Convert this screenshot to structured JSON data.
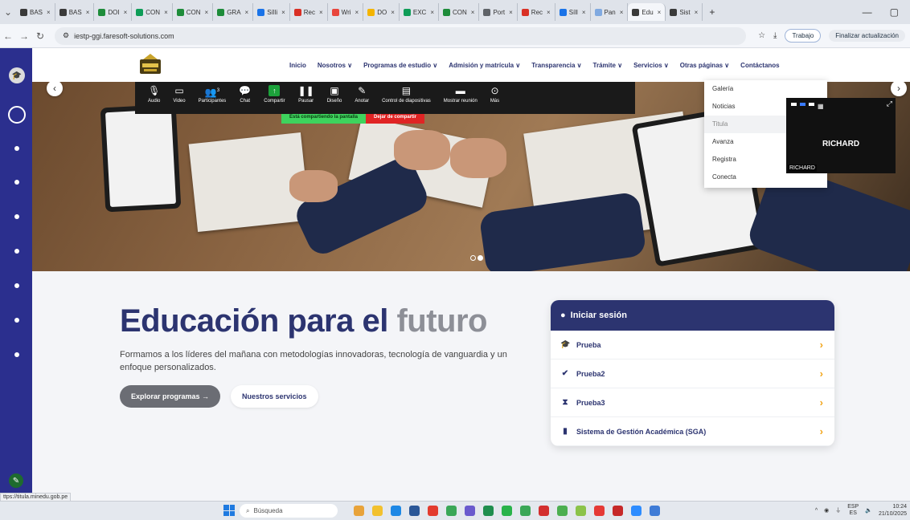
{
  "browser": {
    "tabs": [
      {
        "label": "BAS",
        "color": "#3a3a3a"
      },
      {
        "label": "BAS",
        "color": "#3a3a3a"
      },
      {
        "label": "DOI",
        "color": "#1e8c3a"
      },
      {
        "label": "CON",
        "color": "#0f9d58"
      },
      {
        "label": "CON",
        "color": "#1e8c3a"
      },
      {
        "label": "GRA",
        "color": "#1e8c3a"
      },
      {
        "label": "Sílli",
        "color": "#1a73e8"
      },
      {
        "label": "Rec",
        "color": "#d93025"
      },
      {
        "label": "Wri",
        "color": "#e8453c"
      },
      {
        "label": "DO",
        "color": "#f4b400"
      },
      {
        "label": "EXC",
        "color": "#0f9d58"
      },
      {
        "label": "CON",
        "color": "#1e8c3a"
      },
      {
        "label": "Port",
        "color": "#5f6368"
      },
      {
        "label": "Rec",
        "color": "#d93025"
      },
      {
        "label": "Síll",
        "color": "#1a73e8"
      },
      {
        "label": "Pan",
        "color": "#80a9e0"
      },
      {
        "label": "Edu",
        "color": "#3a3a3a",
        "active": true
      },
      {
        "label": "Sist",
        "color": "#3a3a3a"
      }
    ],
    "url": "iestp-ggi.faresoft-solutions.com",
    "profile_label": "Trabajo",
    "update_label": "Finalizar actualización"
  },
  "site_nav": {
    "items": [
      {
        "label": "Inicio"
      },
      {
        "label": "Nosotros ∨"
      },
      {
        "label": "Programas de estudio ∨"
      },
      {
        "label": "Admisión y matrícula ∨"
      },
      {
        "label": "Transparencia ∨"
      },
      {
        "label": "Trámite ∨"
      },
      {
        "label": "Servicios ∨"
      },
      {
        "label": "Otras páginas ∨"
      },
      {
        "label": "Contáctanos"
      }
    ]
  },
  "dropdown": {
    "items": [
      "Galería",
      "Noticias",
      "Titula",
      "Avanza",
      "Registra",
      "Conecta"
    ],
    "hovered": "Titula"
  },
  "meeting_toolbar": {
    "items": [
      {
        "label": "Audio",
        "icon": "microphone-icon"
      },
      {
        "label": "Video",
        "icon": "video-camera-icon"
      },
      {
        "label": "Participantes",
        "icon": "participants-icon",
        "count": "3"
      },
      {
        "label": "Chat",
        "icon": "chat-icon"
      },
      {
        "label": "Compartir",
        "icon": "share-screen-icon"
      },
      {
        "label": "Pausar",
        "icon": "pause-icon"
      },
      {
        "label": "Diseño",
        "icon": "layout-icon"
      },
      {
        "label": "Anotar",
        "icon": "annotate-pen-icon"
      },
      {
        "label": "Control de diapositivas",
        "icon": "slides-control-icon"
      },
      {
        "label": "Mostrar reunión",
        "icon": "show-meeting-icon"
      },
      {
        "label": "Más",
        "icon": "more-icon"
      }
    ],
    "share_status": "Está compartiendo la pantalla",
    "stop_share": "Dejar de compartir"
  },
  "video_tile": {
    "name": "RICHARD",
    "label": "RICHARD"
  },
  "hero": {
    "headline_main": "Educación para el",
    "headline_accent": "futuro",
    "subtitle": "Formamos a los líderes del mañana con metodologías innovadoras, tecnología de vanguardia y un enfoque personalizados.",
    "primary_button": "Explorar programas →",
    "secondary_button": "Nuestros servicios",
    "slide_count": 2,
    "active_slide": 2
  },
  "login_card": {
    "title": "Iniciar sesión",
    "options": [
      {
        "label": "Prueba",
        "icon": "graduation-icon"
      },
      {
        "label": "Prueba2",
        "icon": "user-check-icon"
      },
      {
        "label": "Prueba3",
        "icon": "hourglass-icon"
      },
      {
        "label": "Sistema de Gestión Académica (SGA)",
        "icon": "book-icon"
      }
    ]
  },
  "status_url": "ttps://titula.minedu.gob.pe",
  "taskbar": {
    "search_placeholder": "Búsqueda",
    "lang_top": "ESP",
    "lang_bottom": "ES",
    "time": "10:24",
    "date": "21/10/2025"
  },
  "colors": {
    "brand_navy": "#2c3470",
    "accent_orange": "#f2a51a",
    "left_strip": "#2b2f8e",
    "share_green": "#3ed35d",
    "stop_red": "#e02424"
  }
}
